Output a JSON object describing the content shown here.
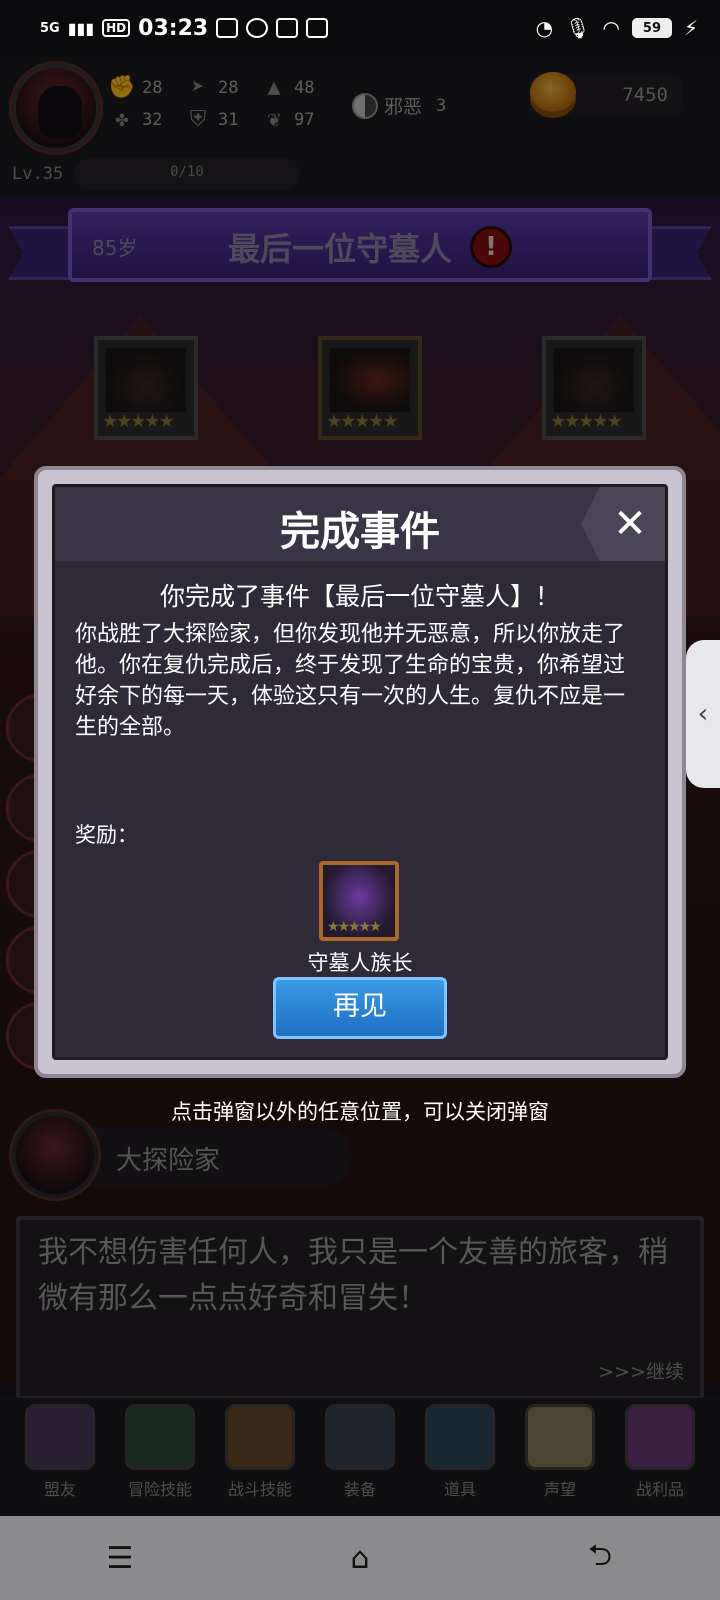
{
  "status_bar": {
    "network": "5G",
    "hd": "HD",
    "time": "03:23",
    "battery": "59"
  },
  "header": {
    "stats": {
      "strength": "28",
      "agility": "28",
      "magic": "48",
      "luck": "32",
      "defense": "31",
      "spirit": "97"
    },
    "alignment": {
      "label": "邪恶",
      "value": "3"
    },
    "gold": "7450",
    "level": "Lv.35",
    "xp": "0/10"
  },
  "event_banner": {
    "age": "85岁",
    "title": "最后一位守墓人",
    "warning": "!"
  },
  "modal": {
    "title": "完成事件",
    "close": "✕",
    "subtitle": "你完成了事件【最后一位守墓人】！",
    "body": "你战胜了大探险家，但你发现他并无恶意，所以你放走了他。你在复仇完成后，终于发现了生命的宝贵，你希望过好余下的每一天，体验这只有一次的人生。复仇不应是一生的全部。",
    "reward_label": "奖励：",
    "reward_name": "守墓人族长",
    "confirm_button": "再见"
  },
  "hint": "点击弹窗以外的任意位置，可以关闭弹窗",
  "dialogue": {
    "speaker": "大探险家",
    "text": "我不想伤害任何人，我只是一个友善的旅客，稍微有那么一点点好奇和冒失！",
    "continue": ">>>继续"
  },
  "tabs": [
    {
      "label": "盟友"
    },
    {
      "label": "冒险技能"
    },
    {
      "label": "战斗技能"
    },
    {
      "label": "装备"
    },
    {
      "label": "道具"
    },
    {
      "label": "声望"
    },
    {
      "label": "战利品"
    }
  ],
  "nav": {
    "menu": "☰",
    "home": "⌂",
    "back": "⮌"
  }
}
